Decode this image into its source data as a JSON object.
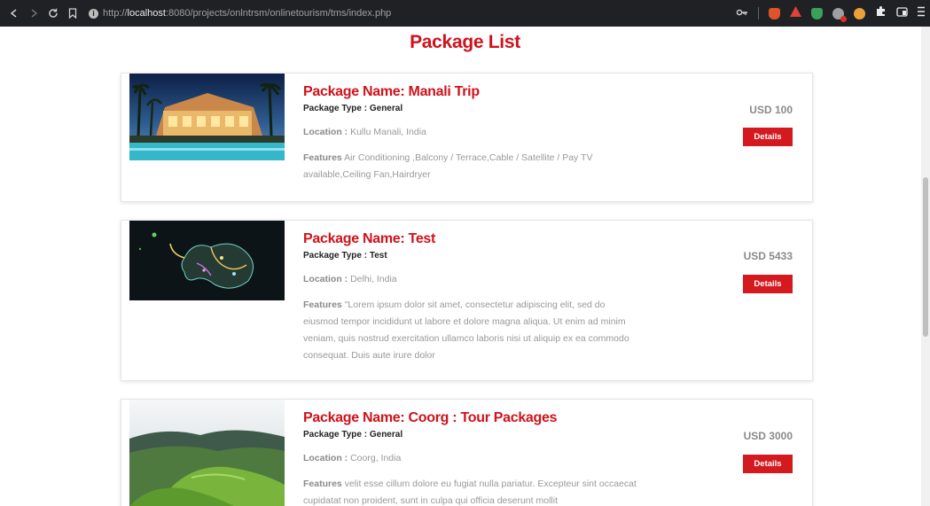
{
  "browser": {
    "url_prefix": "http://",
    "url_host": "localhost",
    "url_path": ":8080/projects/onlntrsm/onlinetourism/tms/index.php"
  },
  "page": {
    "title": "Package List"
  },
  "packages": [
    {
      "name": "Package Name: Manali Trip",
      "type_label": "Package Type : ",
      "type": "General",
      "location_label": "Location : ",
      "location": "Kullu Manali, India",
      "features_label": "Features",
      "features": " Air Conditioning ,Balcony / Terrace,Cable / Satellite / Pay TV available,Ceiling Fan,Hairdryer",
      "price": "USD 100",
      "details_label": "Details"
    },
    {
      "name": "Package Name: Test",
      "type_label": "Package Type : ",
      "type": "Test",
      "location_label": "Location : ",
      "location": "Delhi, India",
      "features_label": "Features",
      "features": " \"Lorem ipsum dolor sit amet, consectetur adipiscing elit, sed do eiusmod tempor incididunt ut labore et dolore magna aliqua. Ut enim ad minim veniam, quis nostrud exercitation ullamco laboris nisi ut aliquip ex ea commodo consequat. Duis aute irure dolor",
      "price": "USD 5433",
      "details_label": "Details"
    },
    {
      "name": "Package Name: Coorg : Tour Packages",
      "type_label": "Package Type : ",
      "type": "General",
      "location_label": "Location : ",
      "location": "Coorg, India",
      "features_label": "Features",
      "features": " velit esse cillum dolore eu fugiat nulla pariatur. Excepteur sint occaecat cupidatat non proident, sunt in culpa qui officia deserunt mollit",
      "price": "USD 3000",
      "details_label": "Details"
    }
  ],
  "colors": {
    "accent": "#d0121b",
    "button": "#d41a1f",
    "muted_text": "#999999",
    "chrome_bg": "#202124"
  },
  "icons": [
    "back-icon",
    "forward-icon",
    "reload-icon",
    "bookmark-icon",
    "site-info-icon",
    "key-icon",
    "brave-shield-icon",
    "brave-rewards-icon",
    "shield-extension-icon",
    "extension-badge-icon",
    "extension-icon",
    "puzzle-icon",
    "sidebar-icon",
    "menu-icon"
  ]
}
